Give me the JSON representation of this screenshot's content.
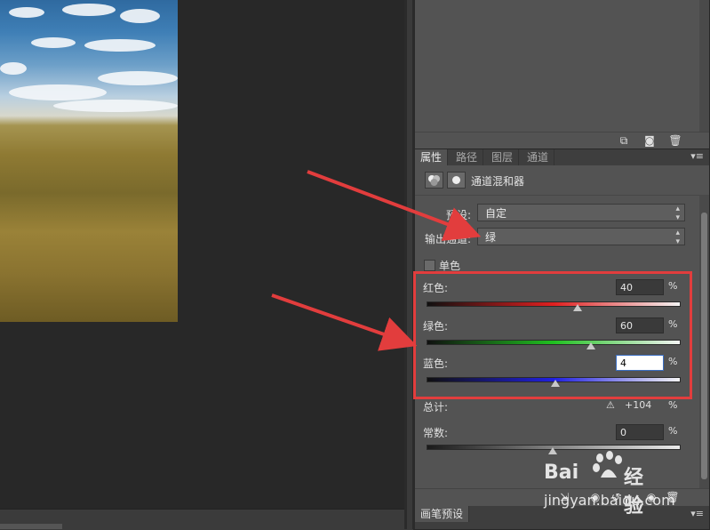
{
  "layers_panel": {
    "footer_icons": [
      "new-adjustment-icon",
      "camera-icon",
      "trash-icon"
    ]
  },
  "tabs": [
    {
      "label": "属性",
      "active": true
    },
    {
      "label": "路径",
      "active": false
    },
    {
      "label": "图层",
      "active": false
    },
    {
      "label": "通道",
      "active": false
    }
  ],
  "adjustment": {
    "title": "通道混和器",
    "preset_label": "预设:",
    "preset_value": "自定",
    "output_label": "输出通道:",
    "output_value": "绿",
    "monochrome_label": "单色",
    "sliders": [
      {
        "label": "红色:",
        "value": "40",
        "unit": "%",
        "color": "#e02020",
        "thumb": 0.6
      },
      {
        "label": "绿色:",
        "value": "60",
        "unit": "%",
        "color": "#20c020",
        "thumb": 0.65
      },
      {
        "label": "蓝色:",
        "value": "4",
        "unit": "%",
        "color": "#2020e0",
        "thumb": 0.51
      }
    ],
    "total_label": "总计:",
    "total_value": "+104",
    "total_unit": "%",
    "constant_label": "常数:",
    "constant_value": "0",
    "constant_unit": "%",
    "constant_thumb": 0.5
  },
  "brush_panel": {
    "label": "画笔预设"
  },
  "watermark": {
    "left": "Bai",
    "right": "经验",
    "url": "jingyan.baidu.com"
  },
  "colors": {
    "highlight": "#e23d3d",
    "arrow": "#e23d3d"
  }
}
